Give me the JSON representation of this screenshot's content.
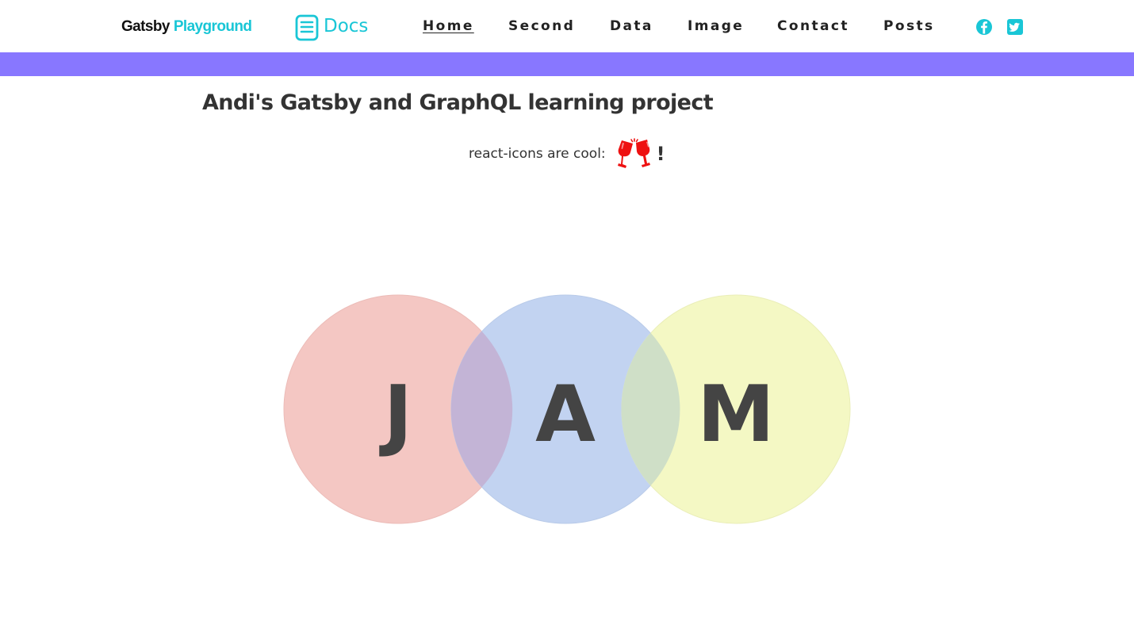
{
  "navbar": {
    "brand_part1": "Gatsby",
    "brand_part2": "Playground",
    "docs_label": "Docs",
    "links": [
      {
        "label": "Home",
        "active": true
      },
      {
        "label": "Second",
        "active": false
      },
      {
        "label": "Data",
        "active": false
      },
      {
        "label": "Image",
        "active": false
      },
      {
        "label": "Contact",
        "active": false
      },
      {
        "label": "Posts",
        "active": false
      }
    ],
    "social_icons": [
      "facebook-icon",
      "twitter-icon"
    ]
  },
  "main": {
    "title": "Andi's Gatsby and GraphQL learning project",
    "subtitle": "react-icons are cool:",
    "subtitle_icon": "cheers-icon",
    "exclamation": "!"
  },
  "hero": {
    "letters": [
      "J",
      "A",
      "M"
    ],
    "circle_colors": [
      "#f4c7c3",
      "#c2d3f1",
      "#f4f8c4"
    ]
  },
  "colors": {
    "accent": "#19c6d6",
    "band": "#8877ff",
    "icon_red": "#ee1111",
    "text": "#333333"
  }
}
